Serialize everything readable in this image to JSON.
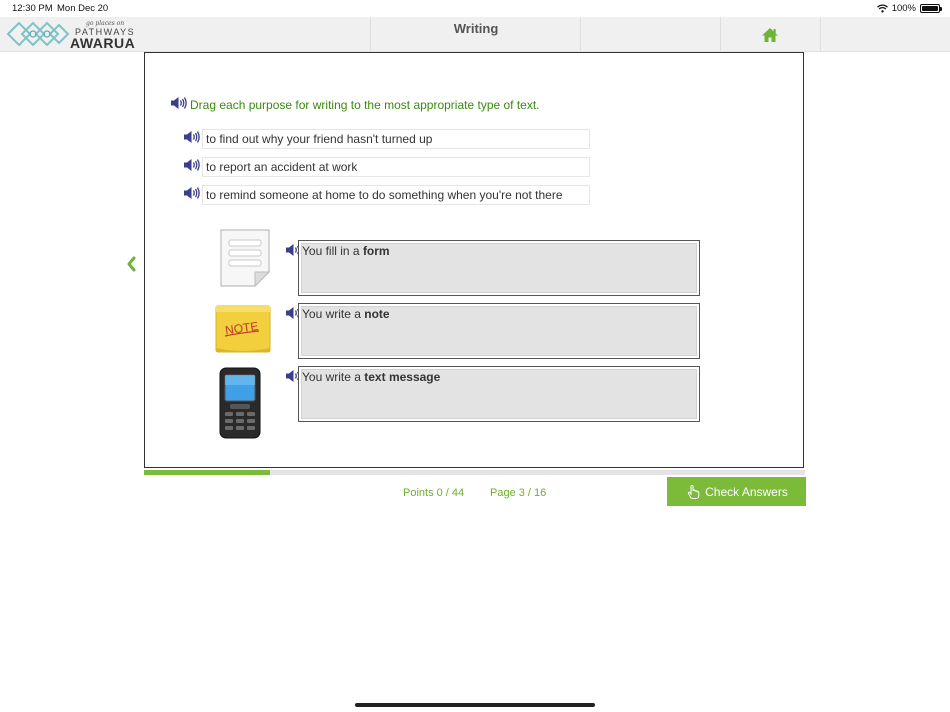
{
  "status_bar": {
    "time": "12:30 PM",
    "date": "Mon Dec 20",
    "battery": "100%"
  },
  "header": {
    "logo_tagline": "go places on",
    "logo_line1": "PATHWAYS",
    "logo_line2": "AWARUA",
    "title": "Writing",
    "home_icon": "home-icon",
    "accent_color": "#7cbb39"
  },
  "activity": {
    "instruction": "Drag each purpose for writing to the most appropriate type of text.",
    "drag_items": [
      {
        "text": "to find out why your friend hasn't turned up"
      },
      {
        "text": "to report an accident at work"
      },
      {
        "text": "to remind someone at home to do something when you're not there"
      }
    ],
    "targets": [
      {
        "prefix": "You fill in a ",
        "bold": "form",
        "image": "form-document-icon"
      },
      {
        "prefix": "You write a ",
        "bold": "note",
        "image": "sticky-note-icon",
        "image_text": "NOTE"
      },
      {
        "prefix": "You write a ",
        "bold": "text message",
        "image": "mobile-phone-icon"
      }
    ]
  },
  "footer": {
    "points": "Points 0 / 44",
    "page": "Page 3 / 16",
    "progress": 0.19,
    "check_answers_label": "Check Answers"
  }
}
